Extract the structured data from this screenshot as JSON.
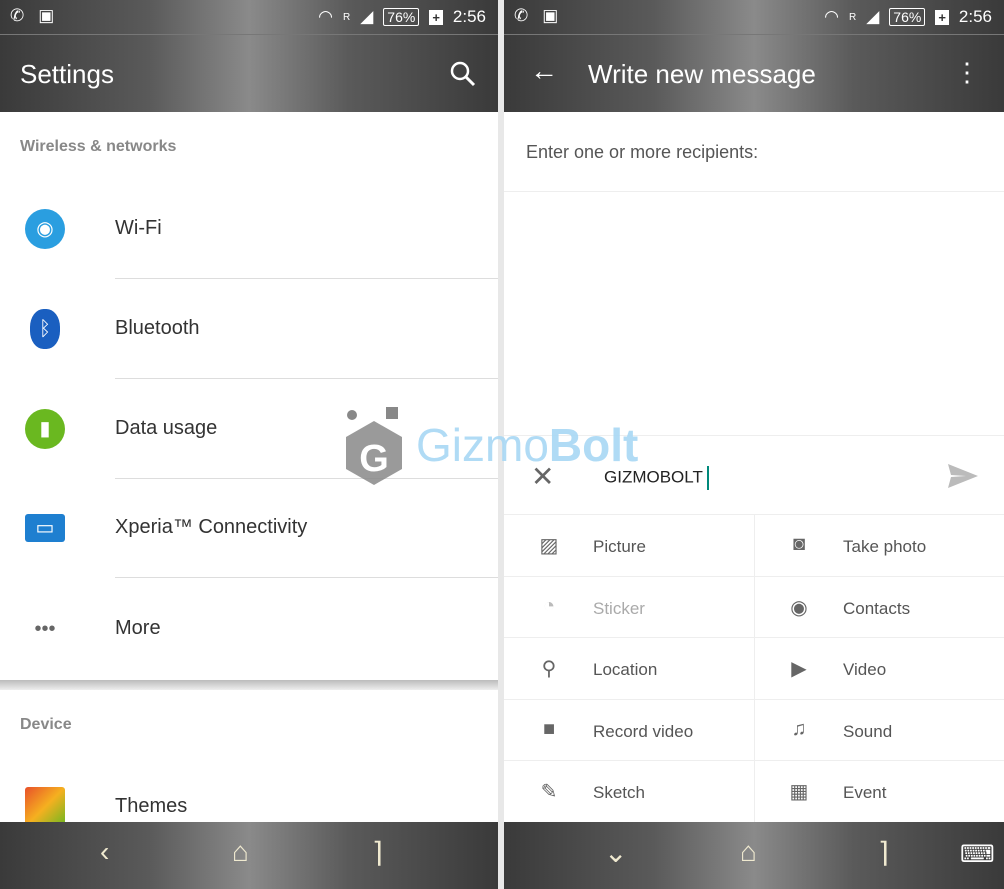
{
  "status": {
    "battery": "76%",
    "charging": "+",
    "time": "2:56",
    "network": "R"
  },
  "left": {
    "title": "Settings",
    "sections": [
      {
        "label": "Wireless & networks"
      },
      {
        "label": "Device"
      }
    ],
    "items": [
      {
        "label": "Wi-Fi",
        "icon": "wifi-icon",
        "color": "#2a9ee0"
      },
      {
        "label": "Bluetooth",
        "icon": "bluetooth-icon",
        "color": "#1a5fc0"
      },
      {
        "label": "Data usage",
        "icon": "data-usage-icon",
        "color": "#6ab820"
      },
      {
        "label": "Xperia™ Connectivity",
        "icon": "xperia-connectivity-icon",
        "color": "#1e7fd0"
      },
      {
        "label": "More",
        "icon": "more-icon",
        "color": "#666666"
      },
      {
        "label": "Themes",
        "icon": "themes-icon",
        "color": "#e8502a"
      }
    ]
  },
  "right": {
    "title": "Write new message",
    "recipients_placeholder": "Enter one or more recipients:",
    "message_text": "GIZMOBOLT",
    "cursor_color": "#00897b",
    "attachments": [
      {
        "label": "Picture",
        "icon": "picture-icon"
      },
      {
        "label": "Take photo",
        "icon": "camera-icon"
      },
      {
        "label": "Sticker",
        "icon": "sticker-icon",
        "disabled": true
      },
      {
        "label": "Contacts",
        "icon": "contacts-icon"
      },
      {
        "label": "Location",
        "icon": "location-icon"
      },
      {
        "label": "Video",
        "icon": "video-icon"
      },
      {
        "label": "Record video",
        "icon": "record-video-icon"
      },
      {
        "label": "Sound",
        "icon": "sound-icon"
      },
      {
        "label": "Sketch",
        "icon": "sketch-icon"
      },
      {
        "label": "Event",
        "icon": "event-icon"
      }
    ]
  },
  "watermark": {
    "part1": "Gizmo",
    "part2": "Bolt"
  }
}
